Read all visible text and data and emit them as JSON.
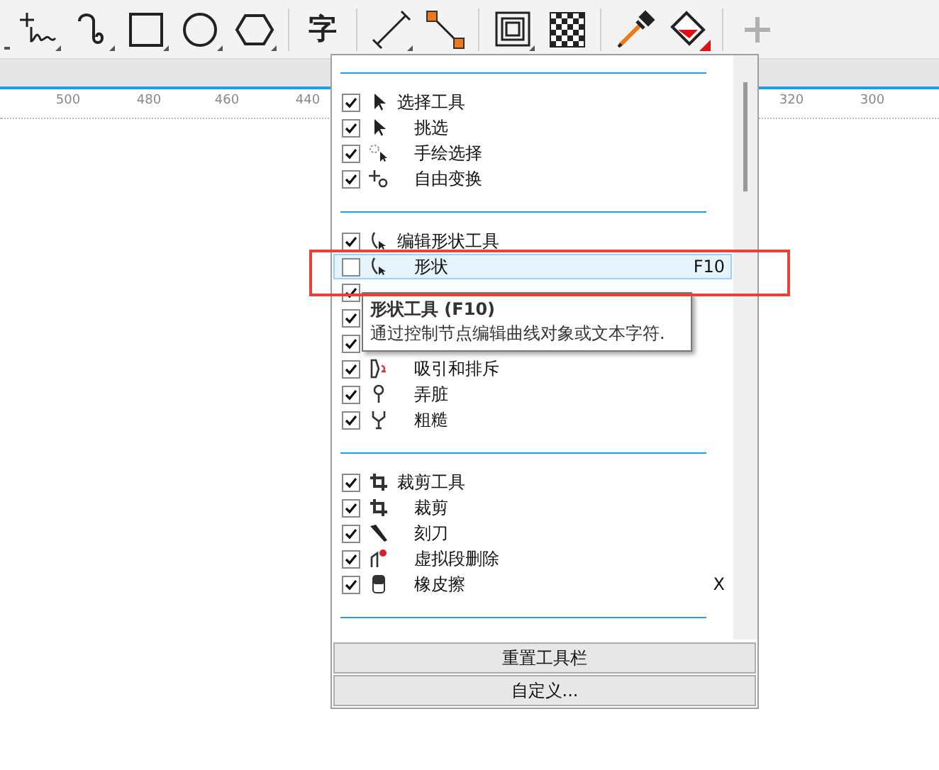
{
  "toolbar": {
    "tools": [
      {
        "kind": "edge"
      },
      {
        "kind": "freehand"
      },
      {
        "kind": "curve"
      },
      {
        "kind": "rectangle"
      },
      {
        "kind": "ellipse"
      },
      {
        "kind": "polygon"
      },
      {
        "kind": "separator"
      },
      {
        "kind": "text",
        "label": "字"
      },
      {
        "kind": "separator"
      },
      {
        "kind": "dimension"
      },
      {
        "kind": "connector"
      },
      {
        "kind": "separator"
      },
      {
        "kind": "frame"
      },
      {
        "kind": "checker"
      },
      {
        "kind": "separator"
      },
      {
        "kind": "eyedropper"
      },
      {
        "kind": "fill"
      },
      {
        "kind": "separator"
      },
      {
        "kind": "add"
      }
    ]
  },
  "ruler": {
    "labels": [
      "500",
      "480",
      "460",
      "440",
      "320",
      "300"
    ]
  },
  "menu": {
    "groups": [
      {
        "label": "选择工具",
        "checked": true,
        "selected": false,
        "children": [
          {
            "label": "挑选",
            "checked": true,
            "selected": false
          },
          {
            "label": "手绘选择",
            "checked": true,
            "selected": false
          },
          {
            "label": "自由变换",
            "checked": true,
            "selected": false
          }
        ]
      },
      {
        "label": "编辑形状工具",
        "checked": true,
        "selected": false,
        "children": [
          {
            "label": "形状",
            "checked": false,
            "selected": true,
            "shortcut": "F10"
          },
          {
            "checked": true,
            "selected": false
          },
          {
            "checked": true,
            "selected": false
          },
          {
            "checked": true,
            "selected": false
          },
          {
            "label": "吸引和排斥",
            "checked": true,
            "selected": false
          },
          {
            "label": "弄脏",
            "checked": true,
            "selected": false
          },
          {
            "label": "粗糙",
            "checked": true,
            "selected": false
          }
        ]
      },
      {
        "label": "裁剪工具",
        "checked": true,
        "selected": false,
        "children": [
          {
            "label": "裁剪",
            "checked": true,
            "selected": false
          },
          {
            "label": "刻刀",
            "checked": true,
            "selected": false
          },
          {
            "label": "虚拟段删除",
            "checked": true,
            "selected": false
          },
          {
            "label": "橡皮擦",
            "checked": true,
            "selected": false,
            "shortcut": "X"
          }
        ]
      }
    ],
    "buttons": [
      "重置工具栏",
      "自定义..."
    ]
  },
  "tooltip": {
    "title": "形状工具 (F10)",
    "text": "通过控制节点编辑曲线对象或文本字符."
  }
}
